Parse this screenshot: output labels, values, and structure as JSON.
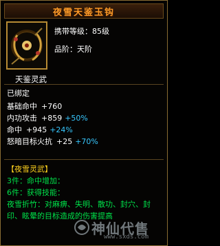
{
  "tooltip": {
    "title": "夜雪天鉴玉钩",
    "carry_level": "携带等级：85级",
    "tier": "品阶：天阶",
    "item_name": "天鉴灵武",
    "bind_status": "已绑定",
    "stats": [
      {
        "label": "基础命中",
        "base": "+760",
        "bonus": ""
      },
      {
        "label": "内功攻击",
        "base": "+859",
        "bonus": "+50%"
      },
      {
        "label": "命中",
        "base": "+945",
        "bonus": "+24%"
      },
      {
        "label": "怒暗目标火抗",
        "base": "+25",
        "bonus": "+70%"
      }
    ],
    "set": {
      "name": "【夜雪灵武】",
      "effects": [
        "3件：命中增加：",
        "6件：获得技能："
      ],
      "skill_desc": "夜雪折竹：对麻痹、失明、散功、封穴、封印、眩晕的目标造成的伤害提高"
    },
    "watermark": {
      "logo": "神仙代售",
      "url": "www.sxds.com"
    }
  },
  "colors": {
    "title": "#ff9b28",
    "bonus": "#37c8ff",
    "set_text": "#00e24a",
    "set_name": "#ffd21e",
    "border": "#8a6d33"
  }
}
